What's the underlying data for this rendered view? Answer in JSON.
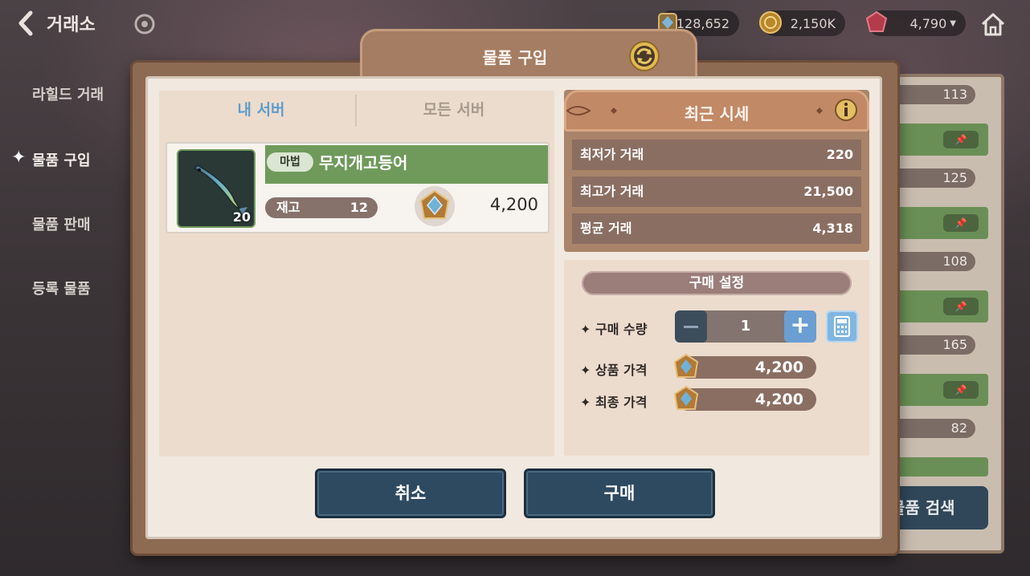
{
  "header": {
    "title": "거래소",
    "currencies": [
      {
        "icon": "crystal-coin-icon",
        "value": "128,652"
      },
      {
        "icon": "gold-coin-icon",
        "value": "2,150K"
      },
      {
        "icon": "red-gem-icon",
        "value": "4,790"
      }
    ]
  },
  "sidebar": {
    "items": [
      {
        "label": "라힐드 거래"
      },
      {
        "label": "물품 구입",
        "active": true
      },
      {
        "label": "물품 판매"
      },
      {
        "label": "등록 물품"
      }
    ]
  },
  "background_list": {
    "counts": [
      "113",
      "125",
      "108",
      "165",
      "82"
    ],
    "search_label": "물품 검색"
  },
  "modal": {
    "title": "물품 구입",
    "tabs": [
      {
        "label": "내 서버",
        "active": true
      },
      {
        "label": "모든 서버"
      }
    ],
    "item": {
      "grade": "마법",
      "name": "무지개고등어",
      "quantity": "20",
      "stock_label": "재고",
      "stock": "12",
      "price": "4,200"
    },
    "recent_prices": {
      "title": "최근 시세",
      "rows": [
        {
          "label": "최저가 거래",
          "value": "220"
        },
        {
          "label": "최고가 거래",
          "value": "21,500"
        },
        {
          "label": "평균 거래",
          "value": "4,318"
        }
      ]
    },
    "purchase_settings": {
      "title": "구매 설정",
      "quantity_label": "✦ 구매 수량",
      "quantity": "1",
      "item_price_label": "✦ 상품 가격",
      "item_price": "4,200",
      "final_price_label": "✦ 최종 가격",
      "final_price": "4,200"
    },
    "buttons": {
      "cancel": "취소",
      "buy": "구매"
    }
  },
  "colors": {
    "accent_blue": "#5e9ccc",
    "item_green": "#6f9a5b",
    "button_navy": "#2d4a61",
    "frame_brown": "#8d6a52"
  }
}
